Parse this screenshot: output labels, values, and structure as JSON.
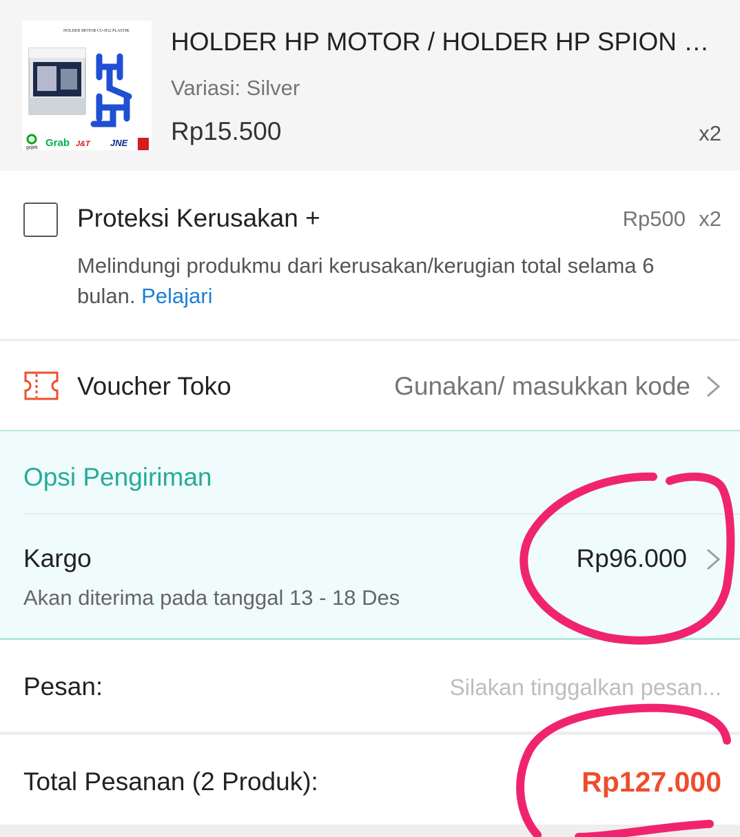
{
  "product": {
    "name": "HOLDER HP MOTOR / HOLDER HP SPION M...",
    "variant": "Variasi: Silver",
    "price": "Rp15.500",
    "quantity": "x2",
    "image_caption": "HOLDER MOTOR CU-H12 PLASTIK",
    "image_logos": [
      "gojek",
      "Grab",
      "J&T",
      "JNE"
    ]
  },
  "protection": {
    "title": "Proteksi Kerusakan +",
    "price": "Rp500",
    "quantity": "x2",
    "description": "Melindungi produkmu dari kerusakan/kerugian total selama 6 bulan.",
    "learn_link": "Pelajari",
    "checked": false
  },
  "voucher": {
    "icon": "ticket-icon",
    "label": "Voucher Toko",
    "hint": "Gunakan/ masukkan kode"
  },
  "shipping": {
    "title": "Opsi Pengiriman",
    "method": "Kargo",
    "price": "Rp96.000",
    "eta": "Akan diterima pada tanggal 13 - 18 Des"
  },
  "message": {
    "label": "Pesan:",
    "placeholder": "Silakan tinggalkan pesan..."
  },
  "total": {
    "label": "Total Pesanan (2 Produk):",
    "value": "Rp127.000"
  },
  "colors": {
    "accent_orange": "#ee4d2d",
    "teal": "#26aa99",
    "link_blue": "#1a7fd6",
    "annotation_pink": "#f0246e"
  }
}
